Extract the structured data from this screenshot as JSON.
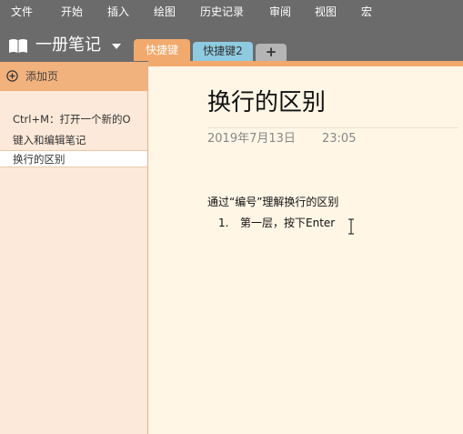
{
  "menu": [
    "文件",
    "开始",
    "插入",
    "绘图",
    "历史记录",
    "审阅",
    "视图",
    "宏"
  ],
  "notebook": {
    "name": "一册笔记",
    "icon": "notebook-icon"
  },
  "tabs": [
    {
      "label": "快捷键",
      "color": "#f2a96d",
      "active": true
    },
    {
      "label": "快捷键2",
      "color": "#8fcbe0",
      "active": false
    }
  ],
  "add_section_label": "+",
  "sidebar": {
    "add_page_label": "添加页",
    "page_preview_lines": [
      "Ctrl+M：打开一个新的O",
      "键入和编辑笔记"
    ],
    "selected_page": "换行的区别"
  },
  "page": {
    "title": "换行的区别",
    "date": "2019年7月13日",
    "time": "23:05",
    "body_line": "通过“编号”理解换行的区别",
    "list_item": {
      "number": "1.",
      "text": "第一层，按下Enter"
    }
  },
  "colors": {
    "chrome": "#6b6b6b",
    "accent": "#f2a96d",
    "sidebar": "#fce9d9",
    "page_bg": "#fff6e6"
  }
}
